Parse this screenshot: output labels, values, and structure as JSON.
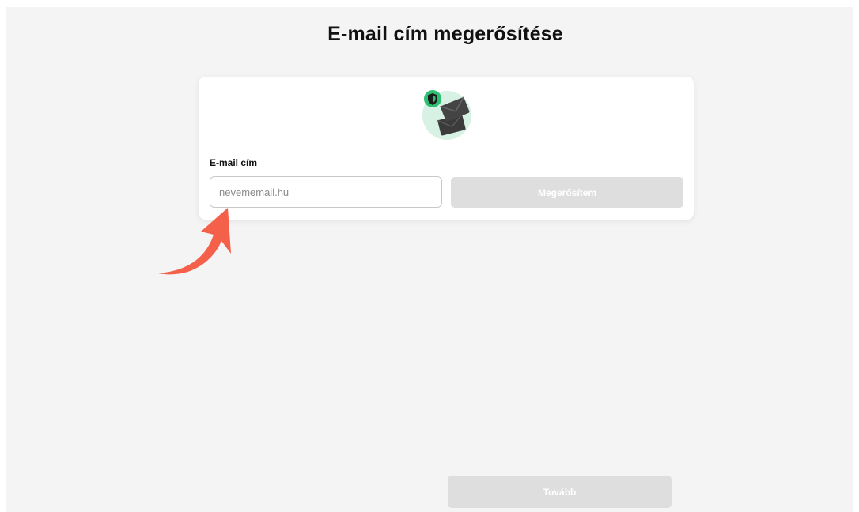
{
  "page": {
    "title": "E-mail cím megerősítése"
  },
  "form": {
    "email_label": "E-mail cím",
    "email_value": "",
    "email_placeholder": "nevememail.hu",
    "confirm_label": "Megerősítem"
  },
  "footer": {
    "next_label": "Tovább"
  },
  "icons": {
    "hero": "envelopes-with-shield-icon",
    "annotation": "curved-arrow-icon"
  },
  "colors": {
    "background": "#f4f4f4",
    "card": "#ffffff",
    "disabled_button": "#dedede",
    "shield_green": "#2fbf72",
    "icon_circle": "#d7f1e4",
    "envelope": "#3b3b3b",
    "annotation_arrow": "#f4604a"
  }
}
